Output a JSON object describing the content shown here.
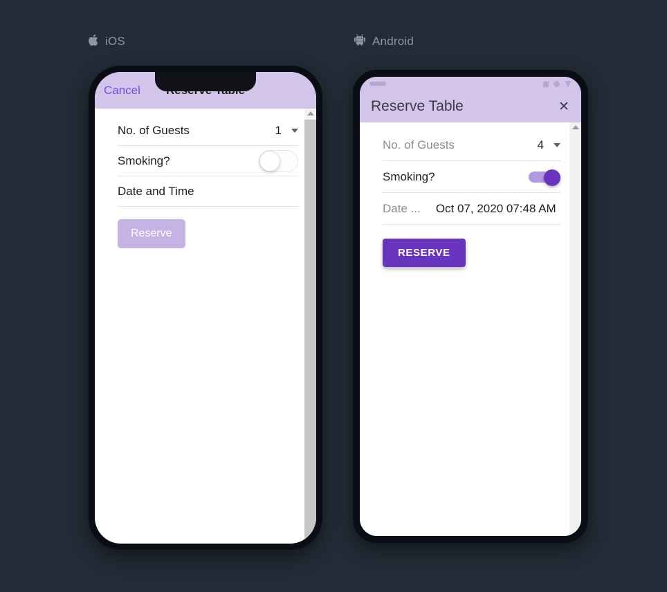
{
  "page": {
    "background_color": "#222b36"
  },
  "platforms": [
    {
      "key": "ios",
      "label": "iOS",
      "icon": "apple-logo-icon"
    },
    {
      "key": "android",
      "label": "Android",
      "icon": "android-robot-icon"
    }
  ],
  "ios": {
    "header": {
      "cancel_label": "Cancel",
      "title": "Reserve Table",
      "background_color": "#d3c5ea",
      "cancel_color": "#7b4ddb"
    },
    "form": {
      "guests": {
        "label": "No. of Guests",
        "value": "1",
        "caret_icon": "chevron-down-icon"
      },
      "smoking": {
        "label": "Smoking?",
        "checked": false,
        "state_text": "off"
      },
      "datetime": {
        "label": "Date and Time",
        "value": ""
      }
    },
    "submit_label": "Reserve",
    "submit_color": "#c5b3e6"
  },
  "android": {
    "header": {
      "title": "Reserve Table",
      "close_icon": "close-icon",
      "close_glyph": "✕",
      "background_color": "#d3c5ea",
      "status_icons": [
        "square-status-icon",
        "circle-status-icon",
        "triangle-status-icon"
      ]
    },
    "form": {
      "guests": {
        "label": "No. of Guests",
        "value": "4",
        "caret_icon": "chevron-down-icon"
      },
      "smoking": {
        "label": "Smoking?",
        "checked": true,
        "state_text": "on"
      },
      "datetime": {
        "label": "Date ...",
        "value": "Oct 07, 2020 07:48 AM"
      }
    },
    "submit_label": "RESERVE",
    "submit_color": "#6a35be"
  }
}
